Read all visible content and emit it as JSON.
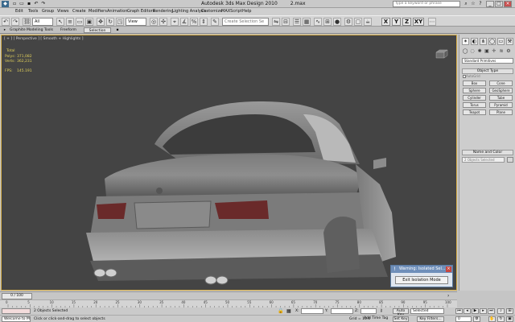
{
  "titlebar": {
    "title": "Autodesk 3ds Max Design 2010",
    "file": "2.max",
    "search_placeholder": "Type a keyword or phrase",
    "app_logo": "3ds-max-logo"
  },
  "menu": [
    "Edit",
    "Tools",
    "Group",
    "Views",
    "Create",
    "Modifiers",
    "Animation",
    "Graph Editors",
    "Rendering",
    "Lighting Analysis",
    "Customize",
    "MAXScript",
    "Help"
  ],
  "toolbar": {
    "selection_filter": "All",
    "reference_coord": "View",
    "named_selection_placeholder": "Create Selection Se",
    "axes": [
      "X",
      "Y",
      "Z",
      "XY"
    ]
  },
  "ribbon": {
    "tabs": [
      "Graphite Modeling Tools",
      "Freeform",
      "Selection"
    ]
  },
  "viewport": {
    "label": "[ + ] [ Perspective ] [ Smooth + Highlights ]",
    "stats": {
      "header": "Total",
      "polys_label": "Polys:",
      "polys_value": "371,082",
      "verts_label": "Verts:",
      "verts_value": "362,231",
      "fps_label": "FPS:",
      "fps_value": "145.191"
    }
  },
  "warning_dialog": {
    "title": "Warning: Isolated Sel...",
    "button": "Exit Isolation Mode"
  },
  "command_panel": {
    "dropdown": "Standard Primitives",
    "object_type_title": "Object Type",
    "autogrid": "AutoGrid",
    "buttons": [
      "Box",
      "Cone",
      "Sphere",
      "GeoSphere",
      "Cylinder",
      "Tube",
      "Torus",
      "Pyramid",
      "Teapot",
      "Plane"
    ],
    "name_color_title": "Name and Color",
    "name_placeholder": "2 Objects Selected"
  },
  "timeline": {
    "frame": "0 / 100",
    "ticks": [
      "0",
      "5",
      "10",
      "15",
      "20",
      "25",
      "30",
      "35",
      "40",
      "45",
      "50",
      "55",
      "60",
      "65",
      "70",
      "75",
      "80",
      "85",
      "90",
      "95",
      "100"
    ]
  },
  "status": {
    "selection": "2 Objects Selected",
    "prompt": "Click or click-and-drag to select objects",
    "maxscript": "Welcome to M",
    "x_label": "X:",
    "y_label": "Y:",
    "z_label": "Z:",
    "grid": "Grid = 10.0",
    "add_time_tag": "Add Time Tag",
    "auto_key": "Auto Key",
    "set_key": "Set Key",
    "key_mode": "Selected",
    "key_filters": "Key Filters...",
    "current_frame": "0"
  },
  "colors": {
    "viewport_bg": "#444444",
    "stats_text": "#e2d15a",
    "dialog_title": "#6f8fba",
    "active_border": "#d8b04a"
  }
}
